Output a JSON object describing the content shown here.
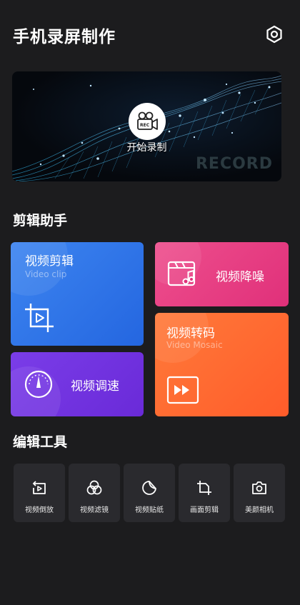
{
  "header": {
    "title": "手机录屏制作",
    "settings_icon": "settings-hexagon-icon"
  },
  "banner": {
    "record_label": "开始录制",
    "watermark": "RECORD",
    "icon": "video-camera-rec-icon",
    "icon_tag": "REC"
  },
  "assistant": {
    "title": "剪辑助手",
    "cards": {
      "clip": {
        "name": "视频剪辑",
        "sub": "Video clip",
        "icon": "crop-play-icon"
      },
      "speed": {
        "name": "视频调速",
        "icon": "speedometer-icon"
      },
      "noise": {
        "name": "视频降噪",
        "icon": "clapper-music-icon"
      },
      "transcode": {
        "name": "视频转码",
        "sub": "Video Mosaic",
        "icon": "fast-forward-icon"
      }
    }
  },
  "tools": {
    "title": "编辑工具",
    "items": [
      {
        "label": "视频倒放",
        "icon": "reverse-play-icon"
      },
      {
        "label": "视频滤镜",
        "icon": "filter-circles-icon"
      },
      {
        "label": "视频贴纸",
        "icon": "sticker-icon"
      },
      {
        "label": "画面剪辑",
        "icon": "frame-crop-icon"
      },
      {
        "label": "美颜相机",
        "icon": "camera-icon"
      }
    ]
  },
  "colors": {
    "background": "#1c1c1e",
    "clip": "#2b6de6",
    "speed": "#6f2fdd",
    "noise": "#e63a82",
    "transcode": "#ff652f",
    "tool_bg": "#2a2a2e"
  }
}
